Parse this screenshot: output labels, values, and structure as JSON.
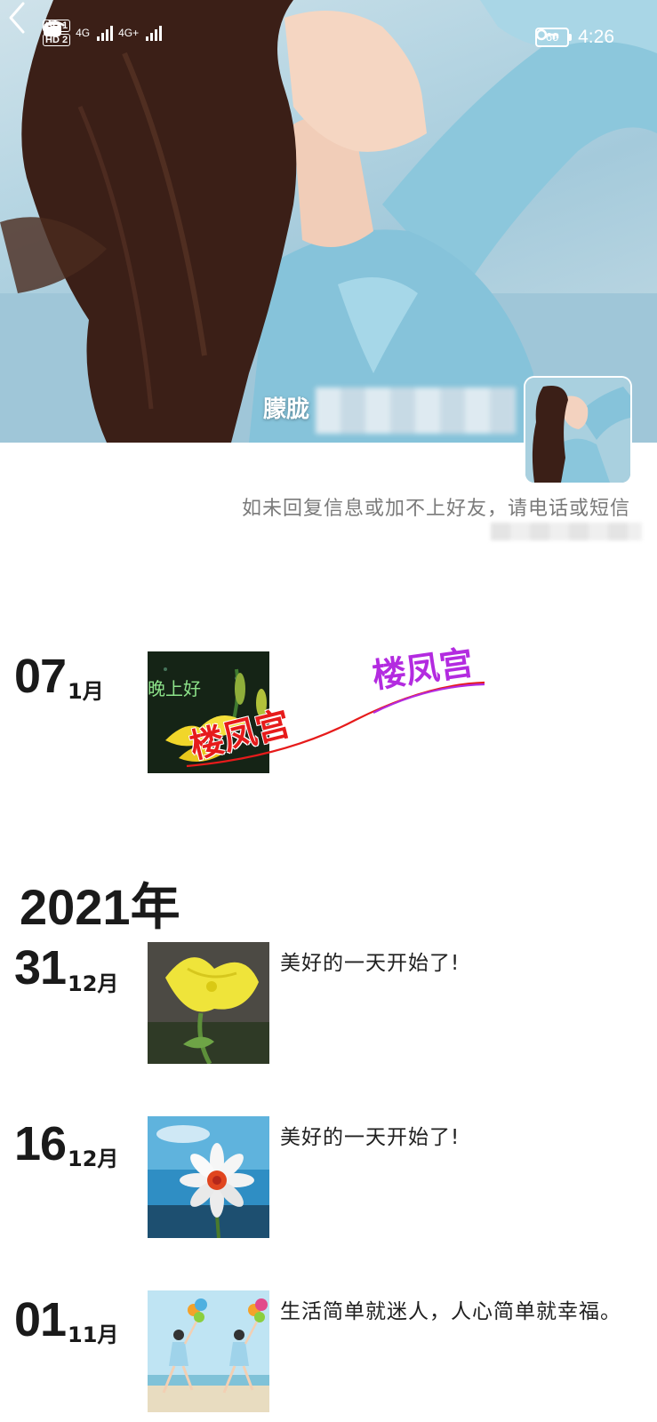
{
  "status_bar": {
    "hd1": "HD 1",
    "hd2": "HD 2",
    "net1": "4G",
    "net2": "4G+",
    "battery": "60",
    "time": "4:26"
  },
  "profile": {
    "name": "朦胧",
    "signature": "如未回复信息或加不上好友，请电话或短信"
  },
  "year_header": "2021年",
  "posts": [
    {
      "day": "07",
      "month": "1月",
      "thumb_caption": "晚上好",
      "watermark": "楼凤宫",
      "text": ""
    },
    {
      "day": "31",
      "month": "12月",
      "text": "美好的一天开始了!"
    },
    {
      "day": "16",
      "month": "12月",
      "text": "美好的一天开始了!"
    },
    {
      "day": "01",
      "month": "11月",
      "text": "生活简单就迷人，人心简单就幸福。"
    }
  ],
  "watermark_text": "楼凤宫",
  "colors": {
    "accent_red": "#e61b1b",
    "accent_purple": "#b32be0",
    "text_dark": "#1a1a1a",
    "text_gray": "#7a7a7a"
  }
}
